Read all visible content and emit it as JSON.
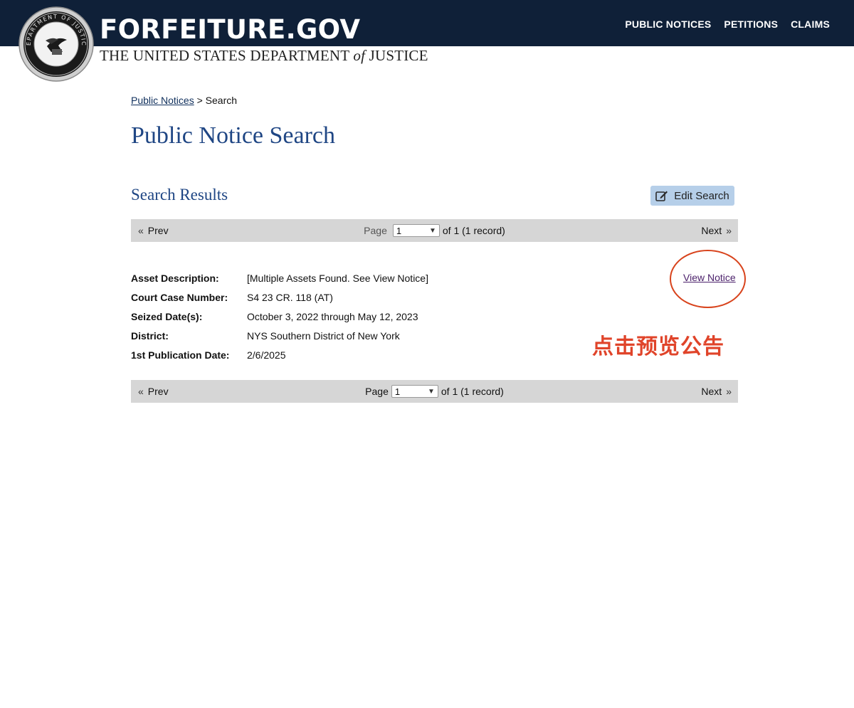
{
  "header": {
    "brand_title": "FORFEITURE.GOV",
    "brand_sub_main": "THE UNITED STATES DEPARTMENT",
    "brand_sub_of": "of",
    "brand_sub_end": "JUSTICE",
    "seal_text": "DEPARTMENT OF JUSTICE",
    "nav": [
      "PUBLIC NOTICES",
      "PETITIONS",
      "CLAIMS"
    ]
  },
  "breadcrumb": {
    "link": "Public Notices",
    "separator": ">",
    "current": "Search"
  },
  "page_title": "Public Notice Search",
  "results": {
    "title": "Search Results",
    "edit_button": "Edit Search",
    "pager": {
      "prev": "Prev",
      "next": "Next",
      "page_label": "Page",
      "page_value": "1",
      "of_text": "of 1 (1 record)"
    },
    "record": {
      "fields": [
        {
          "label": "Asset Description:",
          "value": "[Multiple Assets Found. See View Notice]"
        },
        {
          "label": "Court Case Number:",
          "value": "S4 23 CR. 118 (AT)"
        },
        {
          "label": "Seized Date(s):",
          "value": "October 3, 2022 through May 12, 2023"
        },
        {
          "label": "District:",
          "value": "NYS Southern District of New York"
        },
        {
          "label": "1st Publication Date:",
          "value": "2/6/2025"
        }
      ],
      "view_notice": "View Notice"
    }
  },
  "annotation": {
    "text": "点击预览公告",
    "color": "#e0442a"
  },
  "colors": {
    "header_bg": "#0f2038",
    "title_blue": "#1f4684",
    "edit_button_bg": "#b6cfe9",
    "pager_bg": "#d6d6d6"
  },
  "icons": {
    "edit": "edit-square-icon",
    "prev": "double-chevron-left-icon",
    "next": "double-chevron-right-icon",
    "select": "chevron-down-icon"
  }
}
